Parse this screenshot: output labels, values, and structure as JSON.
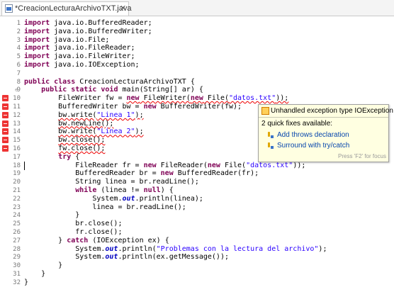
{
  "tab": {
    "title": "*CreacionLecturaArchivoTXT.java",
    "close": "✕"
  },
  "lines": [
    {
      "n": "1",
      "tokens": [
        {
          "t": "import ",
          "c": "kw"
        },
        {
          "t": "java.io.BufferedReader;"
        }
      ]
    },
    {
      "n": "2",
      "tokens": [
        {
          "t": "import ",
          "c": "kw"
        },
        {
          "t": "java.io.BufferedWriter;"
        }
      ]
    },
    {
      "n": "3",
      "tokens": [
        {
          "t": "import ",
          "c": "kw"
        },
        {
          "t": "java.io.File;"
        }
      ]
    },
    {
      "n": "4",
      "tokens": [
        {
          "t": "import ",
          "c": "kw"
        },
        {
          "t": "java.io.FileReader;"
        }
      ]
    },
    {
      "n": "5",
      "tokens": [
        {
          "t": "import ",
          "c": "kw"
        },
        {
          "t": "java.io.FileWriter;"
        }
      ]
    },
    {
      "n": "6",
      "tokens": [
        {
          "t": "import ",
          "c": "kw"
        },
        {
          "t": "java.io.IOException;"
        }
      ]
    },
    {
      "n": "7",
      "tokens": []
    },
    {
      "n": "8",
      "tokens": [
        {
          "t": "public class ",
          "c": "kw"
        },
        {
          "t": "CreacionLecturaArchivoTXT {"
        }
      ]
    },
    {
      "n": "9",
      "fold": true,
      "tokens": [
        {
          "t": "    "
        },
        {
          "t": "public static void ",
          "c": "kw"
        },
        {
          "t": "main(String[] ar) {"
        }
      ]
    },
    {
      "n": "10",
      "error": true,
      "tokens": [
        {
          "t": "        FileWriter fw = "
        },
        {
          "t": "new",
          "c": "kw err"
        },
        {
          "t": " FileWriter(",
          "c": "err"
        },
        {
          "t": "new",
          "c": "kw err"
        },
        {
          "t": " File(",
          "c": "err"
        },
        {
          "t": "\"datos.txt\"",
          "c": "str err"
        },
        {
          "t": "));",
          "c": "err"
        }
      ]
    },
    {
      "n": "11",
      "error": true,
      "tokens": [
        {
          "t": "        BufferedWriter bw = "
        },
        {
          "t": "new",
          "c": "kw"
        },
        {
          "t": " BufferedWriter(fw);"
        }
      ]
    },
    {
      "n": "12",
      "error": true,
      "tokens": [
        {
          "t": "        "
        },
        {
          "t": "bw.write(",
          "c": "err"
        },
        {
          "t": "\"Linea 1\"",
          "c": "str err"
        },
        {
          "t": ");",
          "c": "err"
        }
      ]
    },
    {
      "n": "13",
      "error": true,
      "tokens": [
        {
          "t": "        "
        },
        {
          "t": "bw.newLine();",
          "c": "err"
        }
      ]
    },
    {
      "n": "14",
      "error": true,
      "tokens": [
        {
          "t": "        "
        },
        {
          "t": "bw.write(",
          "c": "err"
        },
        {
          "t": "\"Linea 2\"",
          "c": "str err"
        },
        {
          "t": ");",
          "c": "err"
        }
      ]
    },
    {
      "n": "15",
      "error": true,
      "tokens": [
        {
          "t": "        "
        },
        {
          "t": "bw.close();",
          "c": "err"
        }
      ]
    },
    {
      "n": "16",
      "error": true,
      "tokens": [
        {
          "t": "        "
        },
        {
          "t": "fw.close();",
          "c": "err"
        }
      ]
    },
    {
      "n": "17",
      "tokens": [
        {
          "t": "        "
        },
        {
          "t": "try",
          "c": "kw"
        },
        {
          "t": " {"
        }
      ]
    },
    {
      "n": "18",
      "tokens": [
        {
          "t": "            FileReader fr = "
        },
        {
          "t": "new",
          "c": "kw"
        },
        {
          "t": " FileReader("
        },
        {
          "t": "new",
          "c": "kw"
        },
        {
          "t": " File("
        },
        {
          "t": "\"datos.txt\"",
          "c": "str"
        },
        {
          "t": "));"
        }
      ]
    },
    {
      "n": "19",
      "tokens": [
        {
          "t": "            BufferedReader br = "
        },
        {
          "t": "new",
          "c": "kw"
        },
        {
          "t": " BufferedReader(fr);"
        }
      ]
    },
    {
      "n": "20",
      "tokens": [
        {
          "t": "            String linea = br.readLine();"
        }
      ]
    },
    {
      "n": "21",
      "tokens": [
        {
          "t": "            "
        },
        {
          "t": "while",
          "c": "kw"
        },
        {
          "t": " (linea != "
        },
        {
          "t": "null",
          "c": "kw"
        },
        {
          "t": ") {"
        }
      ]
    },
    {
      "n": "22",
      "tokens": [
        {
          "t": "                System."
        },
        {
          "t": "out",
          "c": "sf"
        },
        {
          "t": ".println(linea);"
        }
      ]
    },
    {
      "n": "23",
      "tokens": [
        {
          "t": "                linea = br.readLine();"
        }
      ]
    },
    {
      "n": "24",
      "tokens": [
        {
          "t": "            }"
        }
      ]
    },
    {
      "n": "25",
      "tokens": [
        {
          "t": "            br.close();"
        }
      ]
    },
    {
      "n": "26",
      "tokens": [
        {
          "t": "            fr.close();"
        }
      ]
    },
    {
      "n": "27",
      "tokens": [
        {
          "t": "        } "
        },
        {
          "t": "catch",
          "c": "kw"
        },
        {
          "t": " (IOException ex) {"
        }
      ]
    },
    {
      "n": "28",
      "tokens": [
        {
          "t": "            System."
        },
        {
          "t": "out",
          "c": "sf"
        },
        {
          "t": ".println("
        },
        {
          "t": "\"Problemas con la lectura del archivo\"",
          "c": "str"
        },
        {
          "t": ");"
        }
      ]
    },
    {
      "n": "29",
      "tokens": [
        {
          "t": "            System."
        },
        {
          "t": "out",
          "c": "sf"
        },
        {
          "t": ".println(ex.getMessage());"
        }
      ]
    },
    {
      "n": "30",
      "tokens": [
        {
          "t": "        }"
        }
      ]
    },
    {
      "n": "31",
      "tokens": [
        {
          "t": "    }"
        }
      ]
    },
    {
      "n": "32",
      "tokens": [
        {
          "t": "}"
        }
      ]
    }
  ],
  "hover": {
    "title": "Unhandled exception type IOException",
    "subtitle": "2 quick fixes available:",
    "fixes": [
      "Add throws declaration",
      "Surround with try/catch"
    ],
    "footer": "Press 'F2' for focus"
  }
}
